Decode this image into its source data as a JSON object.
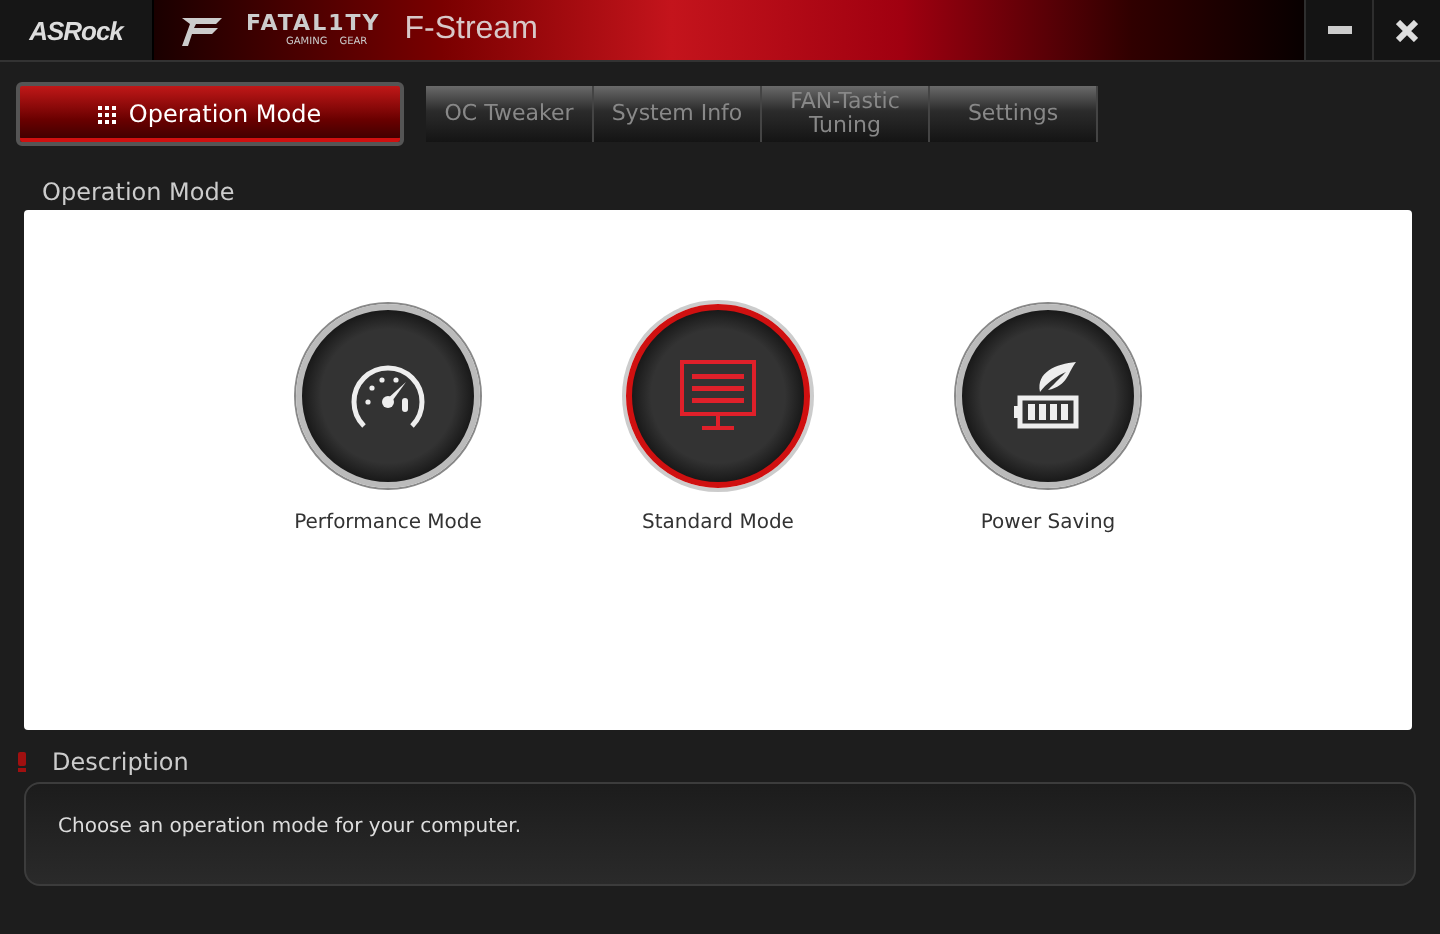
{
  "window": {
    "brand": "ASRock",
    "logo_text": "FATAL1TY",
    "logo_subtext": [
      "GAMING",
      "GEAR"
    ],
    "title": "F-Stream"
  },
  "tabs": [
    {
      "label": "Operation Mode",
      "selected": true
    },
    {
      "label": "OC Tweaker",
      "selected": false
    },
    {
      "label": "System Info",
      "selected": false
    },
    {
      "label": "FAN-Tastic Tuning",
      "selected": false
    },
    {
      "label": "Settings",
      "selected": false
    }
  ],
  "section_title": "Operation Mode",
  "modes": [
    {
      "label": "Performance Mode",
      "kind": "gauge",
      "selected": false
    },
    {
      "label": "Standard Mode",
      "kind": "monitor",
      "selected": true
    },
    {
      "label": "Power Saving",
      "kind": "battery",
      "selected": false
    }
  ],
  "description": {
    "title": "Description",
    "text": "Choose an operation mode for your computer."
  }
}
